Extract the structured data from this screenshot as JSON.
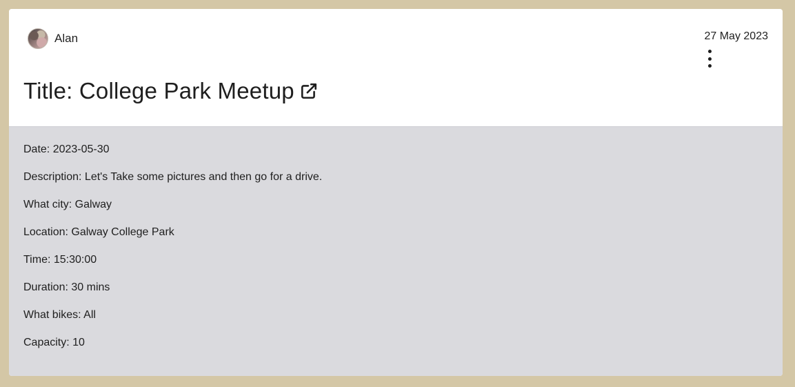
{
  "post": {
    "author": "Alan",
    "posted_date": "27 May 2023",
    "title": "Title: College Park Meetup",
    "details": [
      "Date: 2023-05-30",
      "Description: Let's Take some pictures and then go for a drive.",
      "What city: Galway",
      "Location: Galway College Park",
      "Time: 15:30:00",
      "Duration: 30 mins",
      "What bikes: All",
      "Capacity: 10"
    ]
  },
  "icons": {
    "menu": "more-vertical-icon",
    "external_link": "external-link-icon"
  },
  "colors": {
    "page_background": "#d4c7a6",
    "card_background": "#ffffff",
    "details_background": "#dadade",
    "text": "#1e1e1e"
  }
}
